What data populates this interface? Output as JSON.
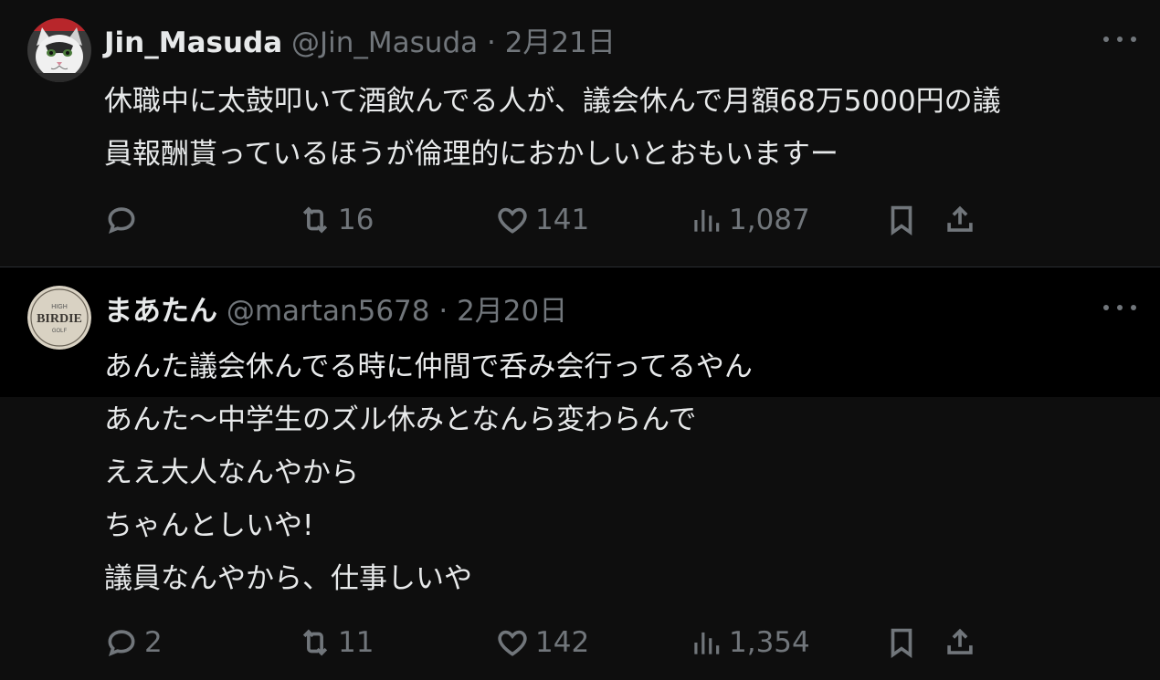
{
  "tweets": [
    {
      "display_name": "Jin_Masuda",
      "handle": "@Jin_Masuda",
      "separator": "·",
      "date": "2月21日",
      "avatar_icon": "cat-avatar-icon",
      "body_lines": [
        "休職中に太鼓叩いて酒飲んでる人が、議会休んで月額68万5000円の議",
        "員報酬貰っているほうが倫理的におかしいとおもいますー"
      ],
      "actions": {
        "reply": "",
        "retweet": "16",
        "like": "141",
        "views": "1,087"
      }
    },
    {
      "display_name": "まあたん",
      "handle": "@martan5678",
      "separator": "·",
      "date": "2月20日",
      "avatar_icon": "birdie-golf-avatar-icon",
      "avatar_text": {
        "top": "HIGH",
        "main": "BIRDIE",
        "bottom": "GOLF"
      },
      "body_lines": [
        "あんた議会休んでる時に仲間で呑み会行ってるやん",
        "あんた～中学生のズル休みとなんら変わらんで",
        "ええ大人なんやから",
        "ちゃんとしいや!",
        "議員なんやから、仕事しいや"
      ],
      "actions": {
        "reply": "2",
        "retweet": "11",
        "like": "142",
        "views": "1,354"
      }
    }
  ],
  "colors": {
    "background": "#0e0e0e",
    "hover_background": "#000000",
    "text_primary": "#e7e9ea",
    "text_secondary": "#71767b",
    "divider": "#2a2d31"
  }
}
